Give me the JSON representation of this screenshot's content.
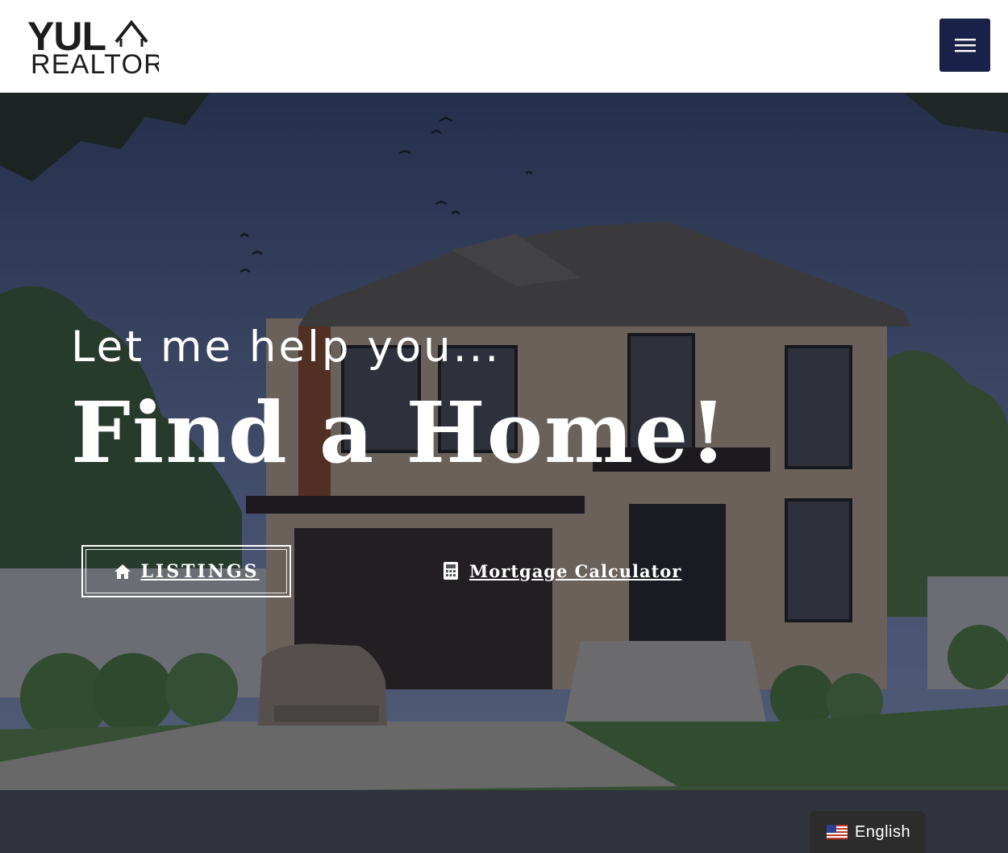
{
  "header": {
    "logo_top": "YUL",
    "logo_bottom": "REALTOR",
    "menu_icon": "hamburger-menu-icon"
  },
  "hero": {
    "kicker": "Let me help you...",
    "headline": "Find a Home!",
    "listings_button": {
      "icon": "home-icon",
      "label": "LISTINGS"
    },
    "calculator_button": {
      "icon": "calculator-icon",
      "label": "Mortgage Calculator"
    }
  },
  "language_switcher": {
    "icon": "us-flag-icon",
    "label": "English"
  },
  "colors": {
    "menu_button": "#1a2149",
    "hero_text": "#ffffff",
    "language_switcher": "#2c2c2c"
  }
}
